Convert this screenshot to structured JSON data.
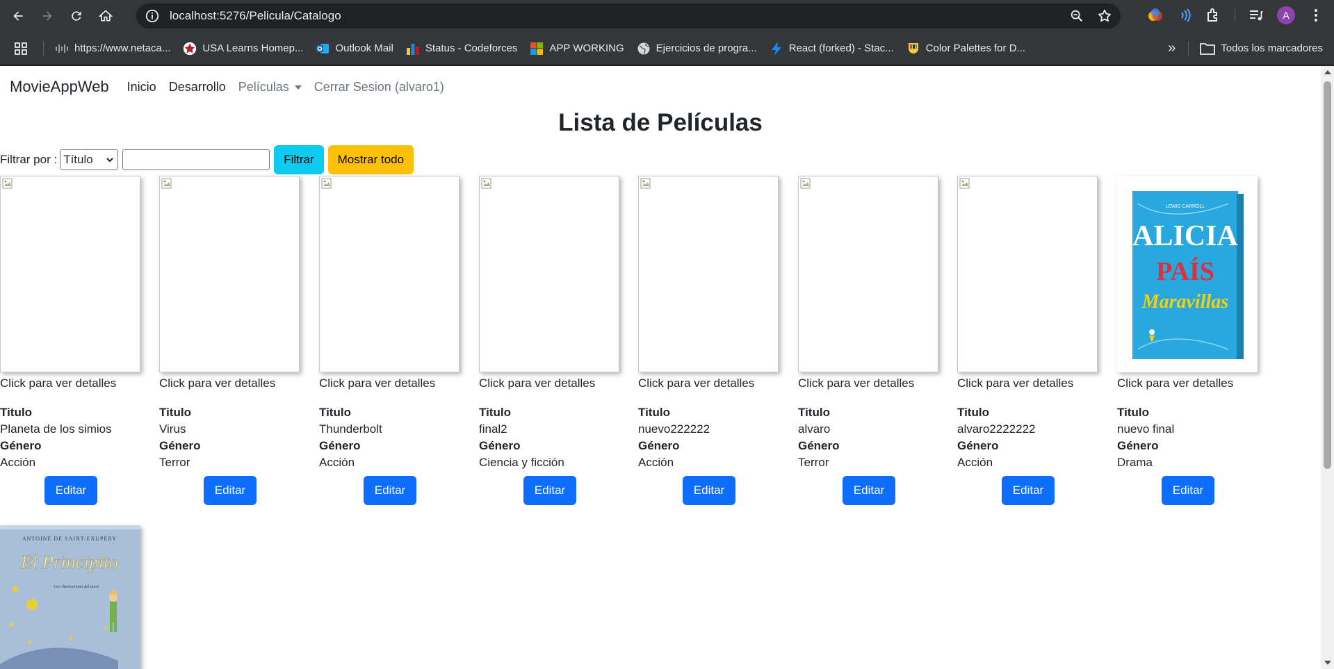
{
  "browser": {
    "url": "localhost:5276/Pelicula/Catalogo",
    "avatar_initial": "A",
    "bookmarks": [
      {
        "label": "https://www.netaca...",
        "icon": "netacad-icon"
      },
      {
        "label": "USA Learns Homep...",
        "icon": "star-icon"
      },
      {
        "label": "Outlook Mail",
        "icon": "outlook-icon"
      },
      {
        "label": "Status - Codeforces",
        "icon": "codeforces-icon"
      },
      {
        "label": "APP WORKING",
        "icon": "windows-icon"
      },
      {
        "label": "Ejercicios de progra...",
        "icon": "globe-icon"
      },
      {
        "label": "React (forked) - Stac...",
        "icon": "bolt-icon"
      },
      {
        "label": "Color Palettes for D...",
        "icon": "palette-icon"
      }
    ],
    "all_bookmarks_label": "Todos los marcadores",
    "overflow_label": "»"
  },
  "navbar": {
    "brand": "MovieAppWeb",
    "links": [
      "Inicio",
      "Desarrollo"
    ],
    "dropdown": "Películas",
    "logout": "Cerrar Sesion (alvaro1)"
  },
  "page": {
    "title": "Lista de Películas",
    "filter_label": "Filtrar por :",
    "filter_selected": "Título",
    "filter_value": "",
    "filter_button": "Filtrar",
    "show_all_button": "Mostrar todo"
  },
  "card_labels": {
    "hint": "Click para ver detalles",
    "title_label": "Titulo",
    "genre_label": "Género",
    "edit_button": "Editar"
  },
  "movies": [
    {
      "titulo": "Planeta de los simios",
      "genero": "Acción",
      "poster": "broken"
    },
    {
      "titulo": "Virus",
      "genero": "Terror",
      "poster": "broken"
    },
    {
      "titulo": "Thunderbolt",
      "genero": "Acción",
      "poster": "broken"
    },
    {
      "titulo": "final2",
      "genero": "Ciencia y ficción",
      "poster": "broken"
    },
    {
      "titulo": "nuevo222222",
      "genero": "Acción",
      "poster": "broken"
    },
    {
      "titulo": "alvaro",
      "genero": "Terror",
      "poster": "broken"
    },
    {
      "titulo": "alvaro2222222",
      "genero": "Acción",
      "poster": "broken"
    },
    {
      "titulo": "nuevo final",
      "genero": "Drama",
      "poster": "alicia-book-cover"
    },
    {
      "poster": "principito-book-cover"
    }
  ],
  "covers": {
    "alicia": {
      "author": "LEWIS CARROLL",
      "line1": "ALICIA",
      "line2": "PAÍS",
      "line3": "Maravillas",
      "colors": {
        "bg": "#29a8df",
        "red": "#d8313f",
        "yellow": "#f4d20a"
      }
    },
    "principito": {
      "author": "ANTOINE DE SAINT-EXUPÉRY",
      "line1": "El Principito",
      "subtitle": "Con ilustraciones del autor",
      "colors": {
        "bg": "#a9bfd9"
      }
    }
  }
}
